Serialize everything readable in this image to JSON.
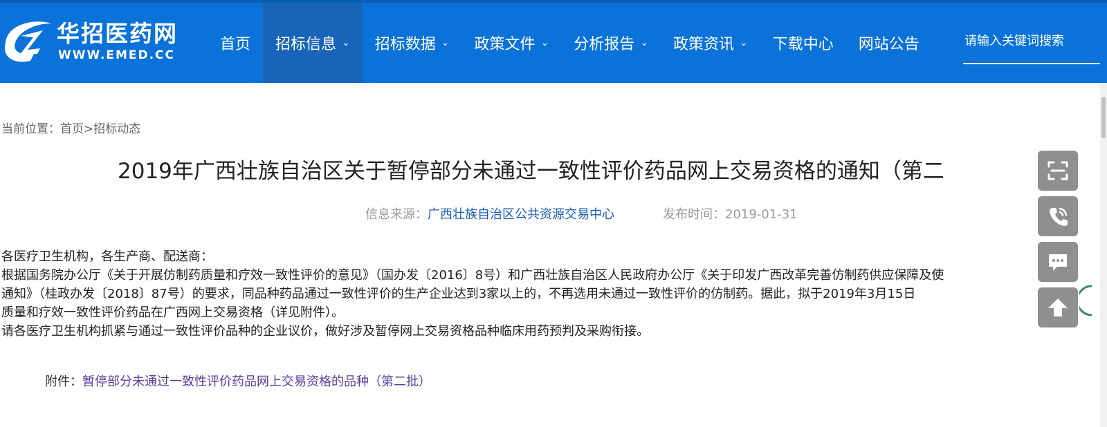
{
  "header": {
    "logo": {
      "name": "华招医药网",
      "url": "WWW.EMED.CC"
    },
    "nav": [
      {
        "label": "首页",
        "has_dropdown": false,
        "active": false
      },
      {
        "label": "招标信息",
        "has_dropdown": true,
        "active": true
      },
      {
        "label": "招标数据",
        "has_dropdown": true,
        "active": false
      },
      {
        "label": "政策文件",
        "has_dropdown": true,
        "active": false
      },
      {
        "label": "分析报告",
        "has_dropdown": true,
        "active": false
      },
      {
        "label": "政策资讯",
        "has_dropdown": true,
        "active": false
      },
      {
        "label": "下载中心",
        "has_dropdown": false,
        "active": false
      },
      {
        "label": "网站公告",
        "has_dropdown": false,
        "active": false
      }
    ],
    "search": {
      "placeholder": "请输入关键词搜索"
    },
    "colors": {
      "bar": "#0a72d8",
      "active_item": "#1764b8"
    }
  },
  "breadcrumb": {
    "prefix": "当前位置：",
    "home": "首页",
    "separator": ">",
    "current": "招标动态"
  },
  "article": {
    "title": "2019年广西壮族自治区关于暂停部分未通过一致性评价药品网上交易资格的通知（第二",
    "source_label": "信息来源：",
    "source": "广西壮族自治区公共资源交易中心",
    "date_label": "发布时间：",
    "date": "2019-01-31",
    "paragraphs": [
      "各医疗卫生机构，各生产商、配送商：",
      "根据国务院办公厅《关于开展仿制药质量和疗效一致性评价的意见》（国办发〔2016〕8号）和广西壮族自治区人民政府办公厅《关于印发广西改革完善仿制药供应保障及使",
      "通知》（桂政办发〔2018〕87号）的要求，同品种药品通过一致性评价的生产企业达到3家以上的，不再选用未通过一致性评价的仿制药。据此，拟于2019年3月15日",
      "质量和疗效一致性评价药品在广西网上交易资格（详见附件）。",
      "请各医疗卫生机构抓紧与通过一致性评价品种的企业议价，做好涉及暂停网上交易资格品种临床用药预判及采购衔接。"
    ],
    "attachment_label": "附件：",
    "attachment_link": "暂停部分未通过一致性评价药品网上交易资格的品种（第二批）"
  },
  "float_tools": [
    {
      "icon": "scan-icon"
    },
    {
      "icon": "phone-icon"
    },
    {
      "icon": "chat-icon"
    },
    {
      "icon": "back-to-top-icon"
    }
  ]
}
